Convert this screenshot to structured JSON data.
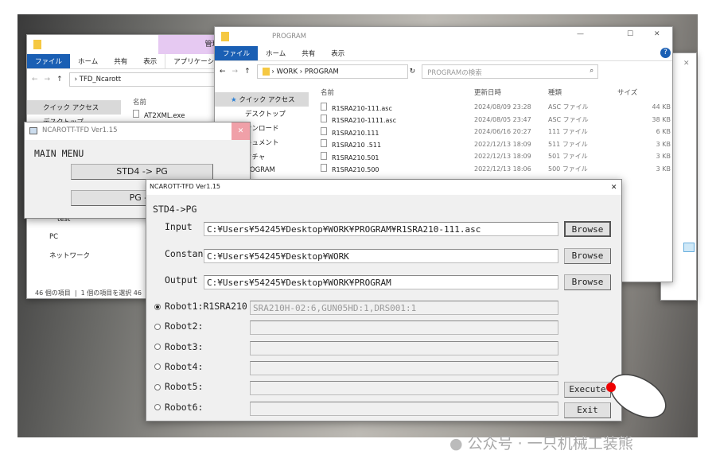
{
  "explorer_back": {
    "tabs": [
      "ファイル",
      "ホーム",
      "共有",
      "表示",
      "アプリケーション ツ"
    ],
    "manage_label": "管理",
    "path": "TFD_Ncarott",
    "header_name": "名前",
    "file": "AT2XML.exe",
    "nav": [
      "クイック アクセス",
      "デスクトップ",
      "test",
      "PC",
      "ネットワーク"
    ],
    "status": "46 個の項目",
    "status_selected": "1 個の項目を選択",
    "status_extra": "46"
  },
  "explorer_program": {
    "title": "PROGRAM",
    "tabs": [
      "ファイル",
      "ホーム",
      "共有",
      "表示"
    ],
    "path": [
      "WORK",
      "PROGRAM"
    ],
    "search_placeholder": "PROGRAMの検索",
    "nav": [
      "クイック アクセス",
      "デスクトップ",
      "ウンロード",
      "キュメント",
      "クチャ",
      "ROGRAM"
    ],
    "columns": [
      "名前",
      "更新日時",
      "種類",
      "サイズ"
    ],
    "files": [
      {
        "name": "R1SRA210-111.asc",
        "date": "2024/08/09 23:28",
        "type": "ASC ファイル",
        "size": "44 KB"
      },
      {
        "name": "R1SRA210-1111.asc",
        "date": "2024/08/05 23:47",
        "type": "ASC ファイル",
        "size": "38 KB"
      },
      {
        "name": "R1SRA210.111",
        "date": "2024/06/16 20:27",
        "type": "111 ファイル",
        "size": "6 KB"
      },
      {
        "name": "R1SRA210 .511",
        "date": "2022/12/13 18:09",
        "type": "511 ファイル",
        "size": "3 KB"
      },
      {
        "name": "R1SRA210.501",
        "date": "2022/12/13 18:09",
        "type": "501 ファイル",
        "size": "3 KB"
      },
      {
        "name": "R1SRA210.500",
        "date": "2022/12/13 18:06",
        "type": "500 ファイル",
        "size": "3 KB"
      }
    ]
  },
  "main_menu": {
    "title": "NCAROTT-TFD Ver1.15",
    "heading": "MAIN MENU",
    "btn1": "STD4 -> PG",
    "btn2": "PG -> "
  },
  "dialog": {
    "title": "NCAROTT-TFD Ver1.15",
    "section": "STD4->PG",
    "input_label": "Input",
    "input_value": "C:¥Users¥54245¥Desktop¥WORK¥PROGRAM¥R1SRA210-111.asc",
    "constant_label": "Constant",
    "constant_value": "C:¥Users¥54245¥Desktop¥WORK",
    "output_label": "Output",
    "output_value": "C:¥Users¥54245¥Desktop¥WORK¥PROGRAM",
    "browse": "Browse",
    "execute": "Execute",
    "exit": "Exit",
    "robots": [
      {
        "label": "Robot1:R1SRA210",
        "value": "SRA210H-02:6,GUN05HD:1,DRS001:1",
        "selected": true
      },
      {
        "label": "Robot2:",
        "value": ""
      },
      {
        "label": "Robot3:",
        "value": ""
      },
      {
        "label": "Robot4:",
        "value": ""
      },
      {
        "label": "Robot5:",
        "value": ""
      },
      {
        "label": "Robot6:",
        "value": ""
      }
    ]
  },
  "watermark": "公众号 · 一只机械工装熊"
}
